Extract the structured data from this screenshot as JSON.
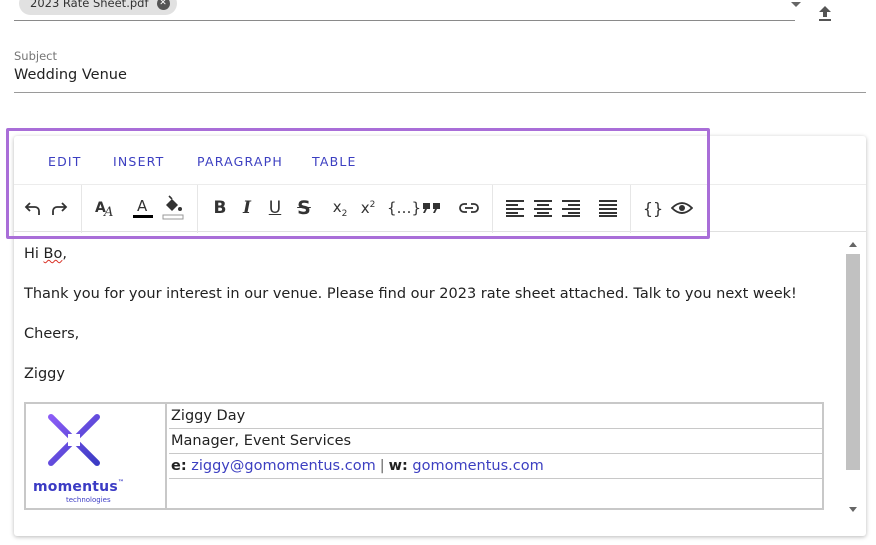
{
  "attachments": {
    "file_name": "2023 Rate Sheet.pdf"
  },
  "subject": {
    "label": "Subject",
    "value": "Wedding Venue"
  },
  "menubar": {
    "edit": "EDIT",
    "insert": "INSERT",
    "paragraph": "PARAGRAPH",
    "table": "TABLE"
  },
  "toolbar": {
    "icons": [
      "undo-icon",
      "redo-icon",
      "format-text-icon",
      "text-color-icon",
      "fill-color-icon",
      "bold-icon",
      "italic-icon",
      "underline-icon",
      "strikethrough-icon",
      "subscript-icon",
      "superscript-icon",
      "placeholder-icon",
      "blockquote-icon",
      "link-icon",
      "align-left-icon",
      "align-center-icon",
      "align-right-icon",
      "justify-icon",
      "source-code-icon",
      "preview-icon"
    ],
    "text_color": "#000000",
    "fill_color": "#ffffff"
  },
  "body": {
    "greeting_prefix": "Hi ",
    "greeting_name": "Bo",
    "greeting_suffix": ",",
    "line1": "Thank you for your interest in our venue. Please find our 2023 rate sheet attached. Talk to you next week!",
    "closing": "Cheers,",
    "sender": "Ziggy"
  },
  "signature": {
    "name": "Ziggy Day",
    "title": "Manager, Event Services",
    "email_label": "e:",
    "email": "ziggy@gomomentus.com",
    "separator": "|",
    "web_label": "w:",
    "web": "gomomentus.com",
    "logo_word": "momentus",
    "logo_tm": "™",
    "logo_sub": "technologies"
  },
  "colors": {
    "accent": "#3c3fc1",
    "highlight_border": "#a96ed8",
    "logo_gradient_start": "#8b5cf6",
    "logo_gradient_end": "#3b3bc4"
  }
}
